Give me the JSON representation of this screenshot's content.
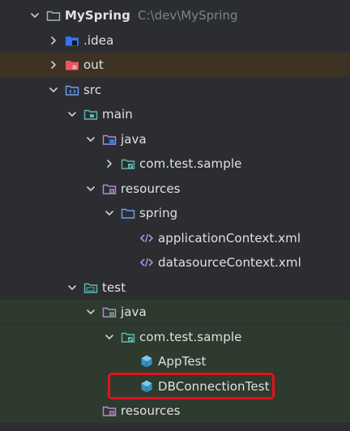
{
  "project": {
    "name": "MySpring",
    "path": "C:\\dev\\MySpring"
  },
  "tree": [
    {
      "label": "MySpring",
      "hint": "C:\\dev\\MySpring",
      "depth": 0,
      "chevron": "open",
      "icon": "project-folder-icon",
      "bold": true
    },
    {
      "label": ".idea",
      "depth": 1,
      "chevron": "closed",
      "icon": "idea-folder-icon"
    },
    {
      "label": "out",
      "depth": 1,
      "chevron": "closed",
      "icon": "excluded-folder-icon",
      "zone": "excluded"
    },
    {
      "label": "src",
      "depth": 1,
      "chevron": "open",
      "icon": "source-folder-icon"
    },
    {
      "label": "main",
      "depth": 2,
      "chevron": "open",
      "icon": "module-folder-icon"
    },
    {
      "label": "java",
      "depth": 3,
      "chevron": "open",
      "icon": "java-source-root-icon"
    },
    {
      "label": "com.test.sample",
      "depth": 4,
      "chevron": "closed",
      "icon": "package-icon"
    },
    {
      "label": "resources",
      "depth": 3,
      "chevron": "open",
      "icon": "resources-root-icon"
    },
    {
      "label": "spring",
      "depth": 4,
      "chevron": "open",
      "icon": "folder-icon"
    },
    {
      "label": "applicationContext.xml",
      "depth": 5,
      "chevron": "none",
      "icon": "xml-file-icon"
    },
    {
      "label": "datasourceContext.xml",
      "depth": 5,
      "chevron": "none",
      "icon": "xml-file-icon"
    },
    {
      "label": "test",
      "depth": 2,
      "chevron": "open",
      "icon": "test-folder-icon"
    },
    {
      "label": "java",
      "depth": 3,
      "chevron": "open",
      "icon": "test-java-root-icon",
      "zone": "test"
    },
    {
      "label": "com.test.sample",
      "depth": 4,
      "chevron": "open",
      "icon": "package-icon",
      "zone": "test"
    },
    {
      "label": "AppTest",
      "depth": 5,
      "chevron": "none",
      "icon": "test-class-icon",
      "zone": "test"
    },
    {
      "label": "DBConnectionTest",
      "depth": 5,
      "chevron": "none",
      "icon": "test-class-icon",
      "zone": "test",
      "highlighted": true
    },
    {
      "label": "resources",
      "depth": 3,
      "chevron": "none",
      "icon": "test-resources-root-icon",
      "zone": "test"
    },
    {
      "label": "",
      "depth": 1,
      "chevron": "open",
      "icon": "source-folder-icon"
    }
  ],
  "colors": {
    "background": "#2b2d30",
    "text": "#dfe1e5",
    "hint": "#7f838a",
    "excluded_row": "#3d3223",
    "test_row": "#2f3a2e",
    "highlight": "#e3101d"
  }
}
